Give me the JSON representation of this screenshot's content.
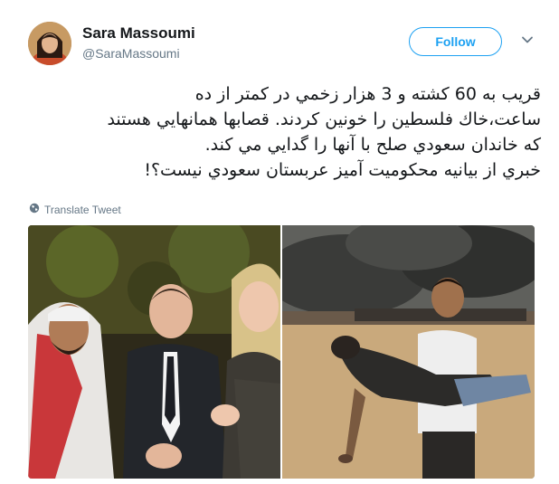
{
  "tweet": {
    "author_name": "Sara Massoumi",
    "author_handle": "@SaraMassoumi",
    "follow_label": "Follow",
    "text_lines": [
      "قريب به 60 كشته و 3 هزار زخمي در كمتر از ده",
      "ساعت،خاك فلسطين را خونين كردند. قصابها همانهايي هستند",
      "كه خاندان سعودي صلح با آنها را گدايي مي كند.",
      "خبري از بيانيه محكوميت آميز عربستان سعودي نيست؟!"
    ],
    "translate_label": "Translate Tweet"
  },
  "icons": {
    "menu": "chevron-down-icon",
    "translate": "globe-icon"
  },
  "colors": {
    "accent": "#1da1f2",
    "secondary_text": "#657786",
    "primary_text": "#14171a"
  }
}
